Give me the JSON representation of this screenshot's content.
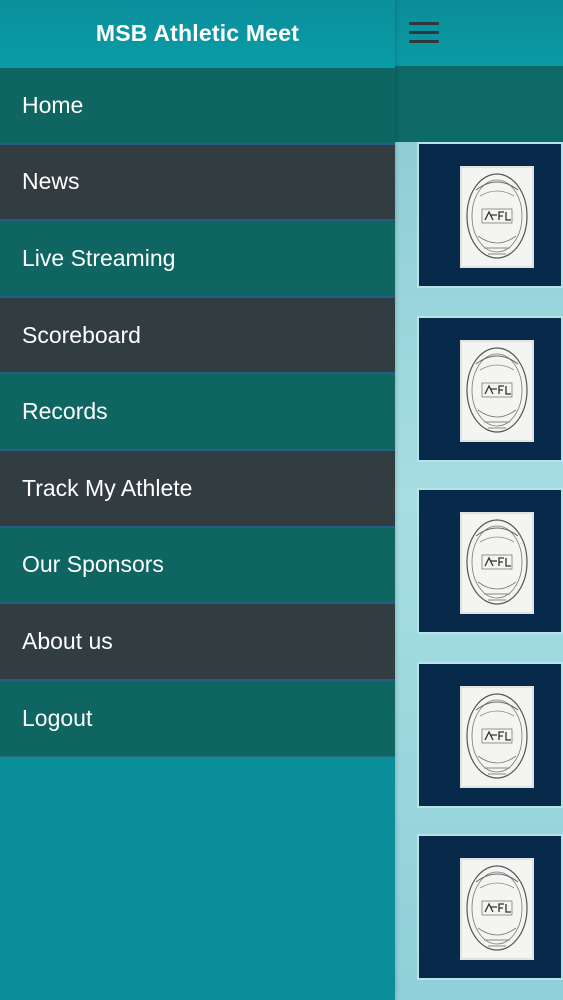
{
  "app": {
    "title": "MSB Athletic Meet"
  },
  "topbar": {
    "menu_icon": "hamburger-icon"
  },
  "menu": {
    "items": [
      {
        "label": "Home"
      },
      {
        "label": "News"
      },
      {
        "label": "Live Streaming"
      },
      {
        "label": "Scoreboard"
      },
      {
        "label": "Records"
      },
      {
        "label": "Track My Athlete"
      },
      {
        "label": "Our Sponsors"
      },
      {
        "label": "About us"
      },
      {
        "label": "Logout"
      }
    ]
  },
  "cards": {
    "count": 5,
    "logo_icon": "msb-crest-logo"
  },
  "colors": {
    "header_teal": "#0a8e9a",
    "menu_teal": "#0e6562",
    "menu_gray": "#313d40",
    "card_navy": "#082a4a",
    "divider_blue": "#245d86"
  }
}
